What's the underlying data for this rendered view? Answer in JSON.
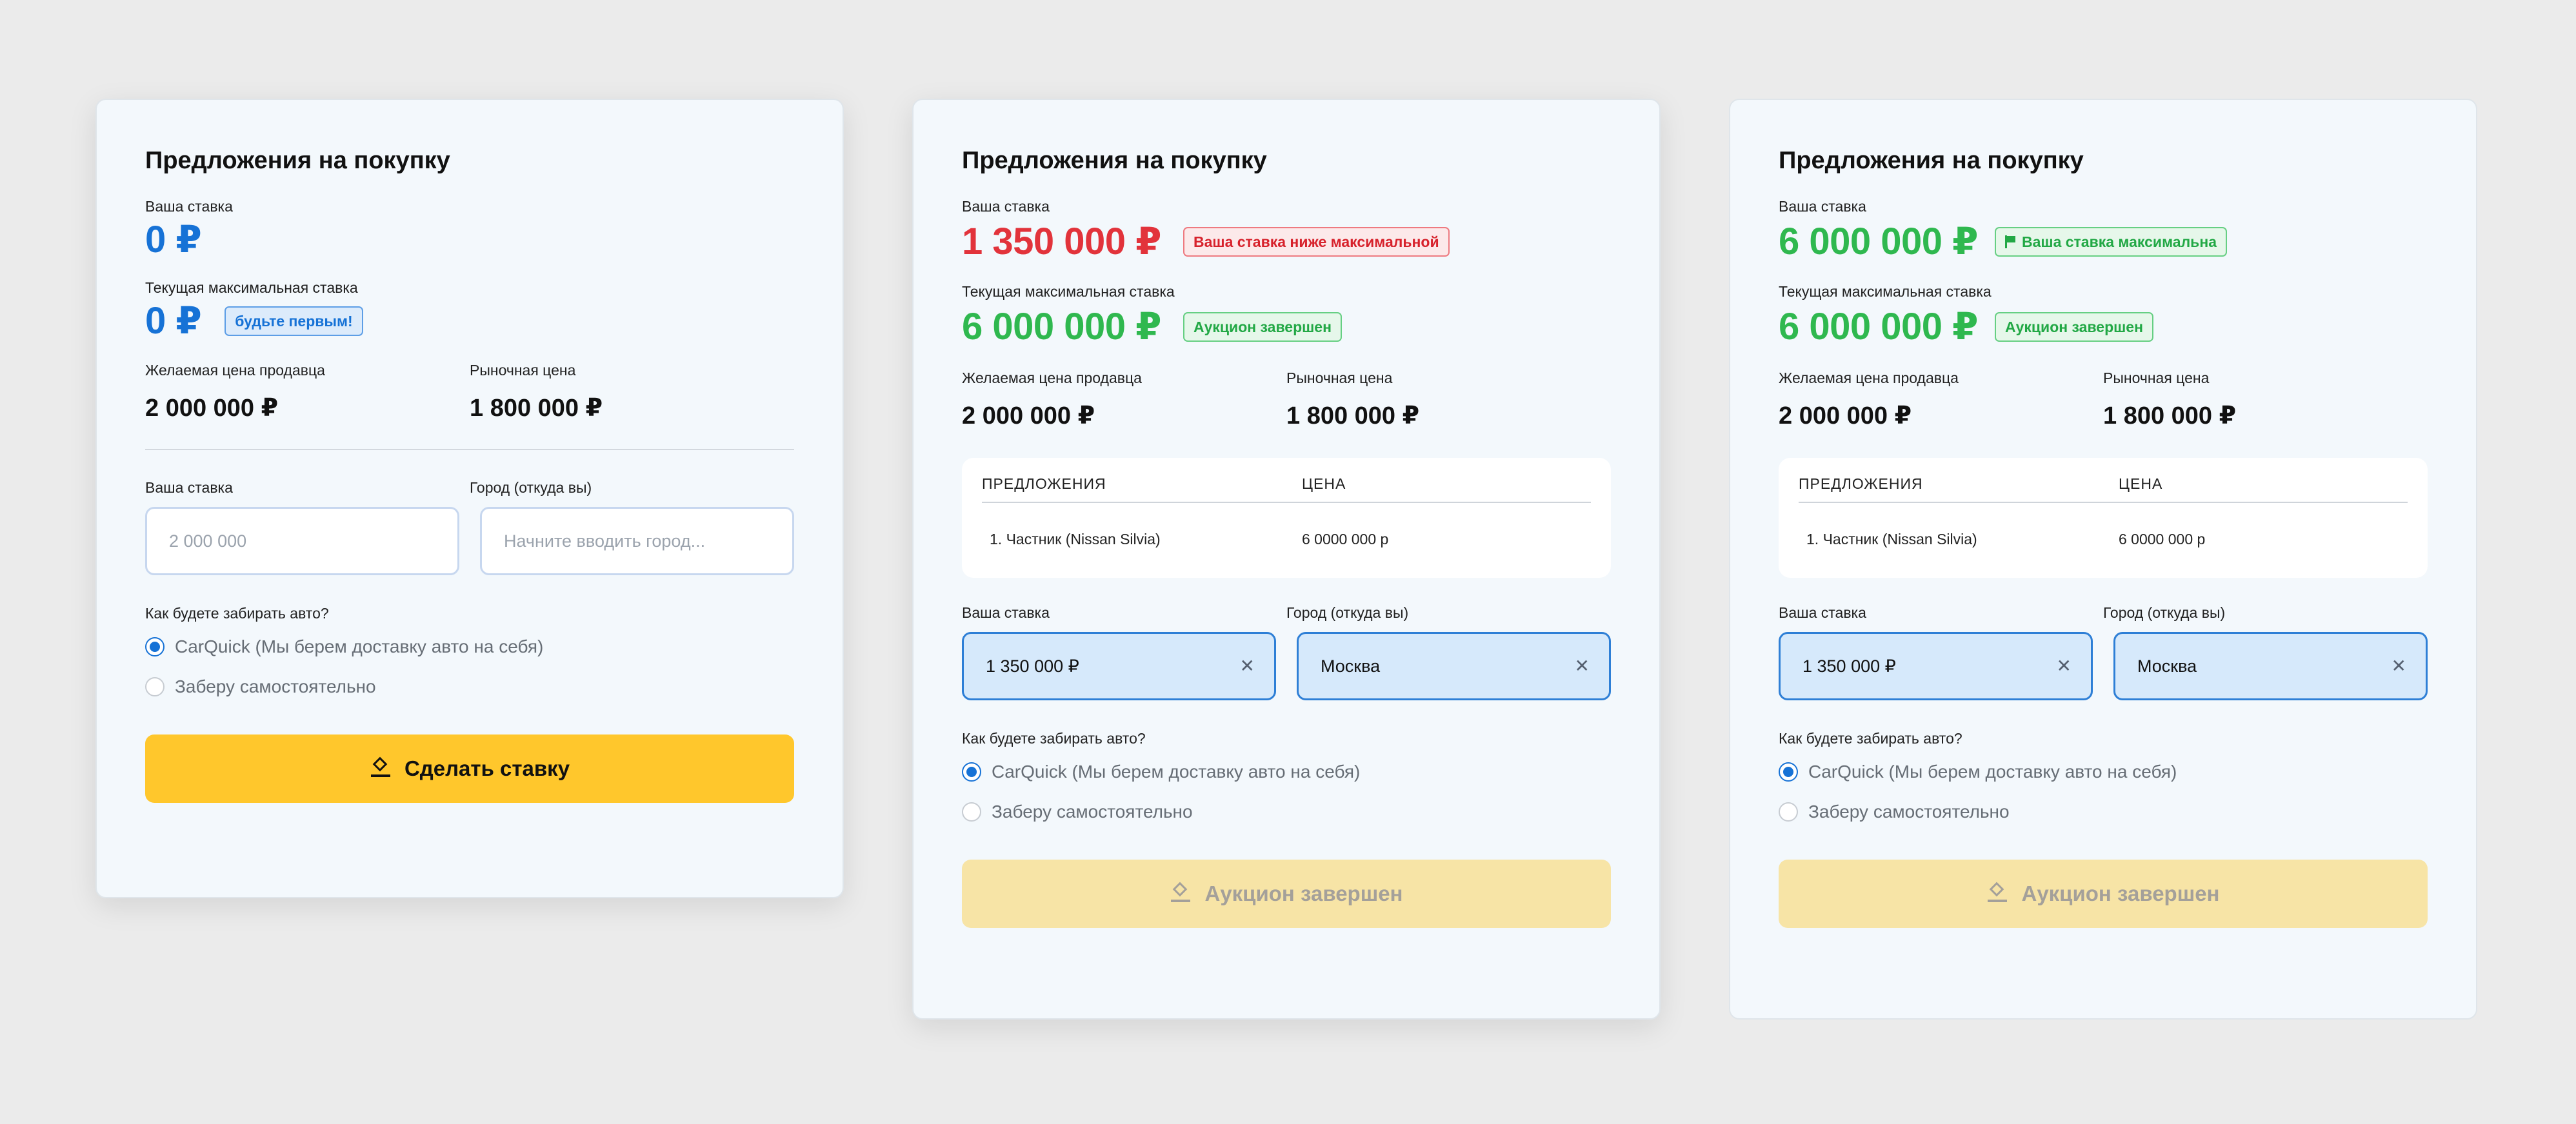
{
  "cards": [
    {
      "title": "Предложения на покупку",
      "bid_label": "Ваша ставка",
      "bid_value": "0 ₽",
      "max_label": "Текущая максимальная ставка",
      "max_value": "0 ₽",
      "max_badge": "будьте первым!",
      "seller_label": "Желаемая цена продавца",
      "seller_value": "2 000 000 ₽",
      "market_label": "Рыночная цена",
      "market_value": "1 800 000 ₽",
      "input_bid_label": "Ваша ставка",
      "input_bid_placeholder": "2 000 000",
      "input_city_label": "Город (откуда вы)",
      "input_city_placeholder": "Начните вводить город...",
      "pickup_question": "Как будете забирать авто?",
      "option_delivery": "CarQuick (Мы берем доставку авто на себя)",
      "option_self": "Заберу самостоятельно",
      "button_label": "Сделать ставку"
    },
    {
      "title": "Предложения на покупку",
      "bid_label": "Ваша ставка",
      "bid_value": "1 350 000 ₽",
      "bid_badge": "Ваша ставка ниже максимальной",
      "max_label": "Текущая максимальная ставка",
      "max_value": "6 000 000 ₽",
      "max_badge": "Аукцион завершен",
      "seller_label": "Желаемая цена продавца",
      "seller_value": "2 000 000 ₽",
      "market_label": "Рыночная цена",
      "market_value": "1 800 000 ₽",
      "offers_col1": "ПРЕДЛОЖЕНИЯ",
      "offers_col2": "ЦЕНА",
      "offers_rows": [
        {
          "name": "1. Частник (Nissan Silvia)",
          "price": "6 0000 000 р"
        }
      ],
      "input_bid_label": "Ваша ставка",
      "input_bid_value": "1 350 000 ₽",
      "input_city_label": "Город (откуда вы)",
      "input_city_value": "Москва",
      "pickup_question": "Как будете забирать авто?",
      "option_delivery": "CarQuick (Мы берем доставку авто на себя)",
      "option_self": "Заберу самостоятельно",
      "button_label": "Аукцион завершен"
    },
    {
      "title": "Предложения на покупку",
      "bid_label": "Ваша ставка",
      "bid_value": "6 000 000 ₽",
      "bid_badge": "Ваша ставка максимальна",
      "max_label": "Текущая максимальная ставка",
      "max_value": "6 000 000 ₽",
      "max_badge": "Аукцион завершен",
      "seller_label": "Желаемая цена продавца",
      "seller_value": "2 000 000 ₽",
      "market_label": "Рыночная цена",
      "market_value": "1 800 000 ₽",
      "offers_col1": "ПРЕДЛОЖЕНИЯ",
      "offers_col2": "ЦЕНА",
      "offers_rows": [
        {
          "name": "1. Частник (Nissan Silvia)",
          "price": "6 0000 000 р"
        }
      ],
      "input_bid_label": "Ваша ставка",
      "input_bid_value": "1 350 000 ₽",
      "input_city_label": "Город (откуда вы)",
      "input_city_value": "Москва",
      "pickup_question": "Как будете забирать авто?",
      "option_delivery": "CarQuick (Мы берем доставку авто на себя)",
      "option_self": "Заберу самостоятельно",
      "button_label": "Аукцион завершен"
    }
  ],
  "icons": {
    "clear": "close-icon",
    "button": "gavel-icon",
    "badge": "flag-icon"
  },
  "colors": {
    "accent_blue": "#1672d6",
    "red": "#e2333b",
    "green": "#2fb84f",
    "button_yellow": "#ffc72c",
    "button_disabled": "#f7e4a6"
  }
}
